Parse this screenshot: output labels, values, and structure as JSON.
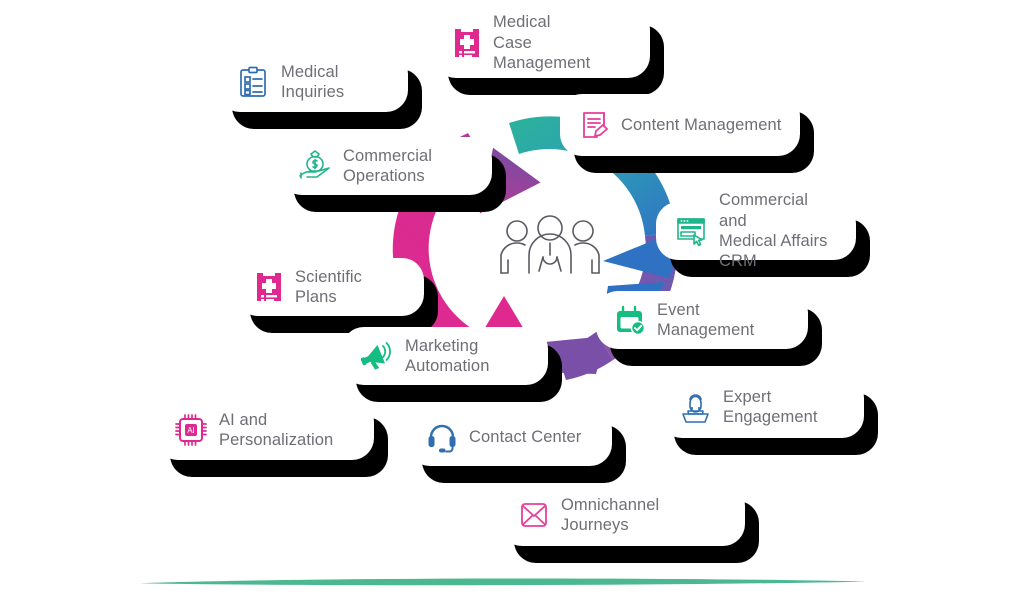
{
  "diagram": {
    "type": "circular-process-diagram",
    "center": {
      "icon": "people-group-icon",
      "label": ""
    },
    "ring": {
      "direction": "clockwise",
      "segment_colors": [
        "#2bb39a",
        "#2e9fb5",
        "#2f72c4",
        "#6b4fa0",
        "#a34a9a",
        "#e0298f"
      ],
      "arrowhead_top_left_color": "#7b4fa3",
      "arrowhead_bottom_left_color": "#e0298f",
      "arrowhead_right_color": "#2f72c4",
      "arrowhead_bottom_right_color": "#7a4fa8"
    },
    "cards": [
      {
        "id": "medical-inquiries",
        "label": "Medical Inquiries",
        "icon": "clipboard-checklist-icon",
        "icon_color": "#2f6fb0"
      },
      {
        "id": "medical-case",
        "label": "Medical\nCase Management",
        "icon": "medical-record-cross-icon",
        "icon_color": "#e0298f"
      },
      {
        "id": "content-management",
        "label": "Content Management",
        "icon": "document-pencil-icon",
        "icon_color": "#e63f9c"
      },
      {
        "id": "commercial-operations",
        "label": "Commercial Operations",
        "icon": "money-bag-hand-icon",
        "icon_color": "#21b58a"
      },
      {
        "id": "crm",
        "label": "Commercial and\nMedical Affairs CRM",
        "icon": "browser-form-cursor-icon",
        "icon_color": "#21b58a"
      },
      {
        "id": "scientific-plans",
        "label": "Scientific Plans",
        "icon": "medical-record-cross-icon",
        "icon_color": "#e0298f"
      },
      {
        "id": "event-management",
        "label": "Event Management",
        "icon": "calendar-check-icon",
        "icon_color": "#15bd81"
      },
      {
        "id": "marketing-automation",
        "label": "Marketing Automation",
        "icon": "megaphone-icon",
        "icon_color": "#15bd81"
      },
      {
        "id": "expert-engagement",
        "label": "Expert Engagement",
        "icon": "speaker-podium-icon",
        "icon_color": "#2f6fb0"
      },
      {
        "id": "ai-personalization",
        "label": "AI and Personalization",
        "icon": "ai-chip-icon",
        "icon_color": "#e0298f"
      },
      {
        "id": "contact-center",
        "label": "Contact Center",
        "icon": "headset-icon",
        "icon_color": "#2f6fb0"
      },
      {
        "id": "omnichannel-journeys",
        "label": "Omnichannel Journeys",
        "icon": "envelope-icon",
        "icon_color": "#e63f9c"
      }
    ],
    "footer": {
      "line_color": "#4cb891",
      "background": "#ffffff"
    },
    "theme": {
      "card_background": "#ffffff",
      "card_shadow": "#000000",
      "label_color": "#6e6e76",
      "page_background": "#ffffff"
    }
  }
}
